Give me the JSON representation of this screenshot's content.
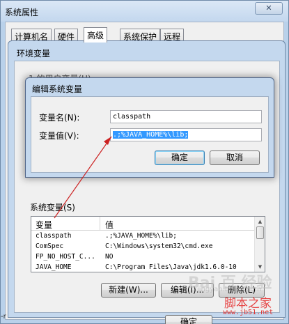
{
  "system_properties": {
    "title": "系统属性",
    "close_label": "✕",
    "tabs": [
      "计算机名",
      "硬件",
      "高级",
      "系统保护",
      "远程"
    ],
    "active_tab": "高级"
  },
  "env_vars": {
    "title": "环境变量",
    "user_vars_label": "1    的用户变量(U)",
    "system_vars_label": "系统变量(S)",
    "columns": [
      "变量",
      "值"
    ],
    "rows": [
      {
        "name": "classpath",
        "value": ".;%JAVA_HOME%\\lib;"
      },
      {
        "name": "ComSpec",
        "value": "C:\\Windows\\system32\\cmd.exe"
      },
      {
        "name": "FP_NO_HOST_C...",
        "value": "NO"
      },
      {
        "name": "JAVA_HOME",
        "value": "C:\\Program Files\\Java\\jdk1.6.0-10"
      }
    ],
    "buttons": {
      "new": "新建(W)...",
      "edit": "编辑(I)...",
      "delete": "删除(L)"
    },
    "ok_label": "确定"
  },
  "edit_dialog": {
    "title": "编辑系统变量",
    "name_label": "变量名(N):",
    "value_label": "变量值(V):",
    "name_value": "classpath",
    "value_value": ".;%JAVA_HOME%\\lib;",
    "ok": "确定",
    "cancel": "取消"
  },
  "watermarks": {
    "baidu": "Bai 百 经验",
    "baidu_url": "jingyan.baidu.com",
    "site": "脚本之家",
    "site_url": "www.jb51.net",
    "fragment": "-r"
  },
  "colors": {
    "selection": "#3399ff",
    "arrow": "#cc2222",
    "title_bg": "#c4d8ee"
  }
}
